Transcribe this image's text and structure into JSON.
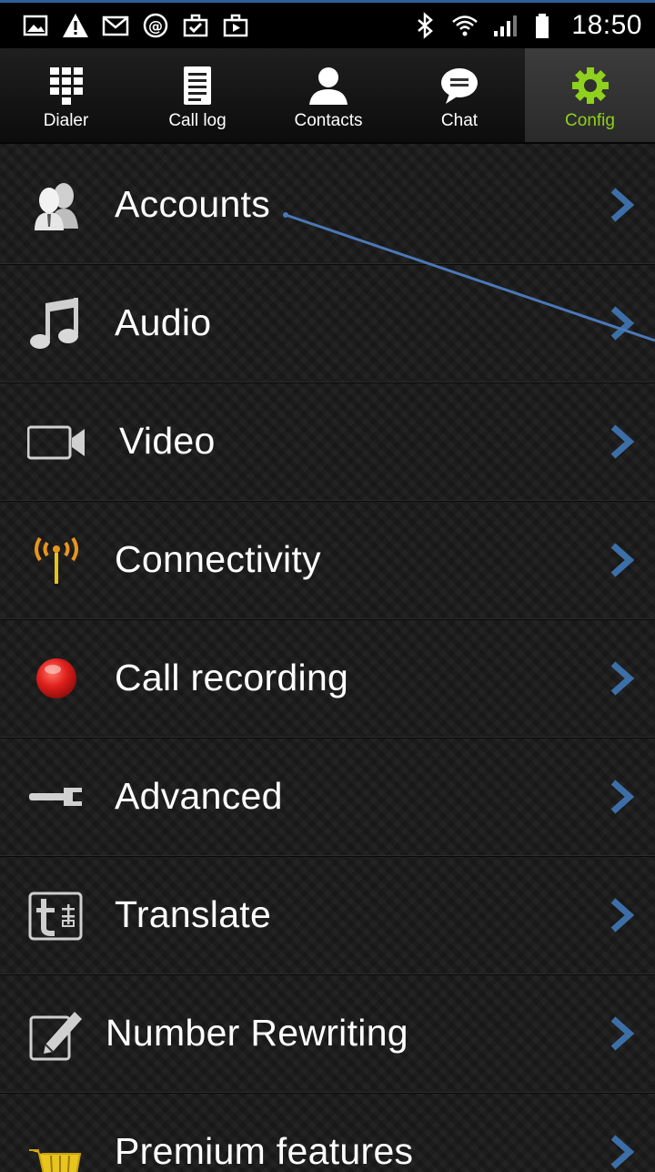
{
  "status_bar": {
    "time": "18:50",
    "left_icons": [
      "gallery-icon",
      "warning-icon",
      "mail-icon",
      "at-icon",
      "briefcase-check-icon",
      "briefcase-play-icon"
    ],
    "right_icons": [
      "bluetooth-icon",
      "wifi-icon",
      "signal-icon",
      "battery-icon"
    ]
  },
  "tabs": [
    {
      "label": "Dialer",
      "icon": "dialpad-icon"
    },
    {
      "label": "Call log",
      "icon": "list-icon"
    },
    {
      "label": "Contacts",
      "icon": "person-icon"
    },
    {
      "label": "Chat",
      "icon": "chat-bubble-icon"
    },
    {
      "label": "Config",
      "icon": "gear-icon",
      "active": true
    }
  ],
  "menu": [
    {
      "label": "Accounts",
      "icon": "accounts-icon"
    },
    {
      "label": "Audio",
      "icon": "music-note-icon"
    },
    {
      "label": "Video",
      "icon": "video-camera-icon"
    },
    {
      "label": "Connectivity",
      "icon": "antenna-icon"
    },
    {
      "label": "Call recording",
      "icon": "record-icon"
    },
    {
      "label": "Advanced",
      "icon": "wrench-icon"
    },
    {
      "label": "Translate",
      "icon": "translate-icon"
    },
    {
      "label": "Number Rewriting",
      "icon": "edit-icon"
    },
    {
      "label": "Premium features",
      "icon": "cart-icon"
    }
  ],
  "colors": {
    "accent_active": "#8fd11c",
    "chevron": "#3c6fa8",
    "annotation_line": "#4a78b8",
    "record_red": "#e0201c",
    "antenna_orange": "#e8951e"
  }
}
